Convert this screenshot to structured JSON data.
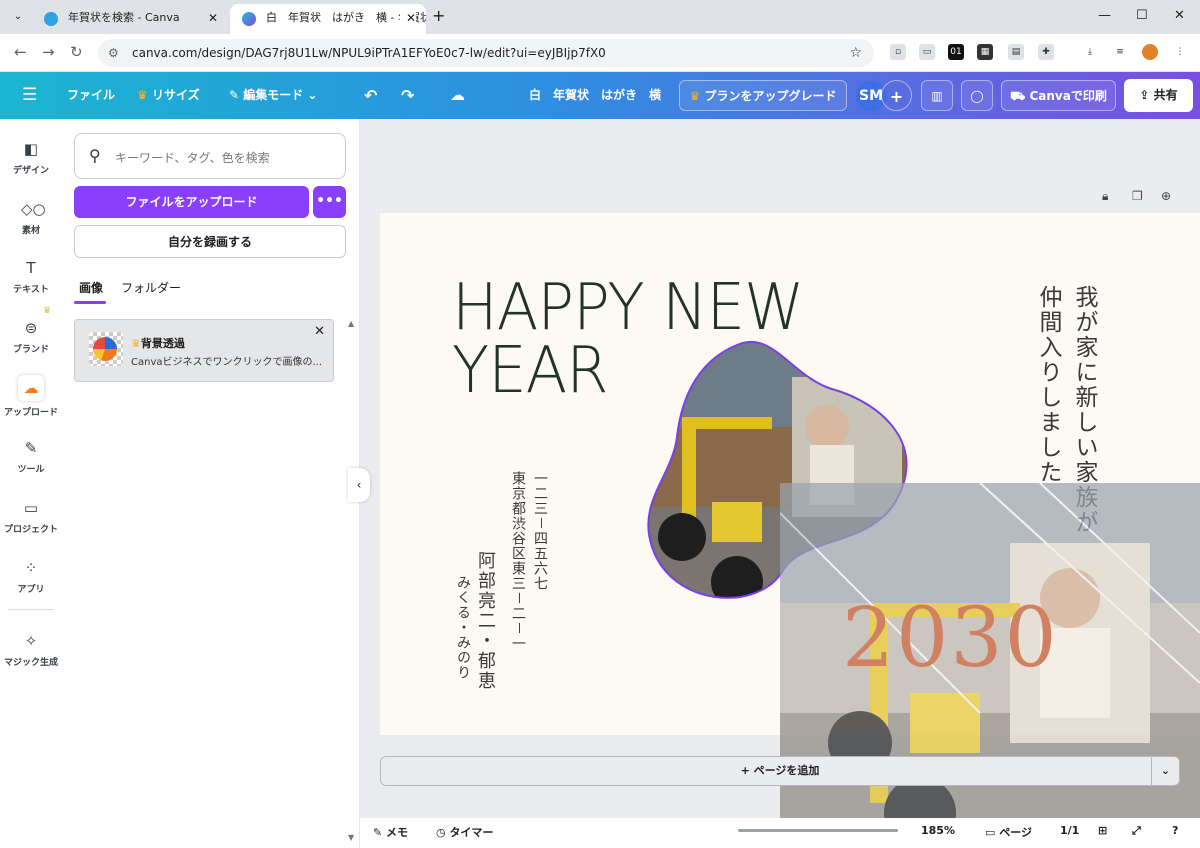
{
  "browser": {
    "tabs": [
      {
        "title": "年賀状を検索 - Canva",
        "active": false
      },
      {
        "title": "白　年賀状　はがき　横 - 年賀状",
        "active": true
      }
    ],
    "url": "canva.com/design/DAG7rj8U1Lw/NPUL9iPTrA1EFYoE0c7-lw/edit?ui=eyJBIjp7fX0",
    "window_controls": [
      "—",
      "☐",
      "✕"
    ],
    "extensions": [
      "bookmark",
      "cast",
      "01",
      "qr",
      "screen",
      "puzzle",
      "download",
      "media",
      "profile"
    ]
  },
  "topbar": {
    "menu_icon": "hamburger-icon",
    "file": "ファイル",
    "resize": "リサイズ",
    "edit_mode": "編集モード",
    "title": "白　年賀状　はがき　横",
    "upgrade": "プランをアップグレード",
    "avatar": "SM",
    "print": "Canvaで印刷",
    "share": "共有"
  },
  "rail": [
    {
      "label": "デザイン",
      "icon": "design-icon"
    },
    {
      "label": "素材",
      "icon": "elements-icon"
    },
    {
      "label": "テキスト",
      "icon": "text-icon"
    },
    {
      "label": "ブランド",
      "icon": "brand-icon"
    },
    {
      "label": "アップロード",
      "icon": "upload-icon"
    },
    {
      "label": "ツール",
      "icon": "tools-icon"
    },
    {
      "label": "プロジェクト",
      "icon": "folder-icon"
    },
    {
      "label": "アプリ",
      "icon": "apps-icon"
    },
    {
      "label": "マジック生成",
      "icon": "magic-icon"
    }
  ],
  "panel": {
    "search_placeholder": "キーワード、タグ、色を検索",
    "upload_button": "ファイルをアップロード",
    "more": "•••",
    "record_button": "自分を録画する",
    "tabs": [
      "画像",
      "フォルダー"
    ],
    "promo": {
      "title": "背景透過",
      "desc": "Canvaビジネスでワンクリックで画像の..."
    }
  },
  "card_design": {
    "headline": [
      "HAPPY NEW",
      "YEAR"
    ],
    "message": [
      "我が家に新しい家族が",
      "仲間入りしました"
    ],
    "address": [
      "一二三－四五六七",
      "東京都渋谷区東三－二－一"
    ],
    "names": [
      "阿部亮二・郁恵",
      "みくる・みのり"
    ],
    "year": "2030"
  },
  "canvas": {
    "add_page": "+ ページを追加"
  },
  "bottombar": {
    "notes": "メモ",
    "timer": "タイマー",
    "zoom": "185%",
    "pages": "ページ",
    "page_count": "1/1"
  },
  "colors": {
    "accent": "#8a3ffc",
    "gradient_start": "#1bb5d0",
    "gradient_end": "#7a4fe0",
    "headline": "#223525",
    "year": "#c0542a"
  }
}
